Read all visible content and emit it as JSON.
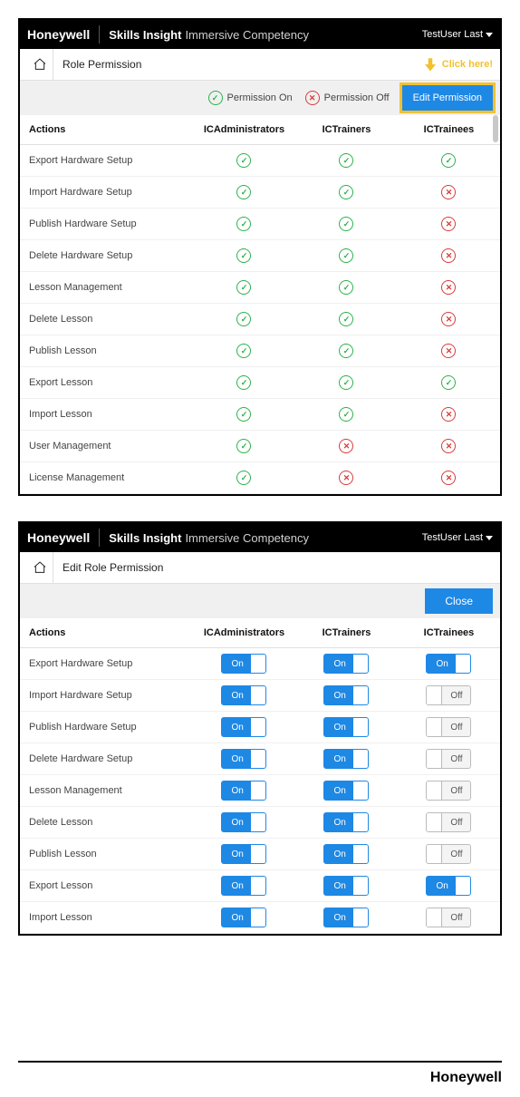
{
  "brand": "Honeywell",
  "app": {
    "name": "Skills Insight",
    "subtitle": "Immersive Competency"
  },
  "user": "TestUser Last",
  "panel1": {
    "breadcrumb": "Role Permission",
    "callout": "Click here!",
    "legend_on": "Permission On",
    "legend_off": "Permission Off",
    "edit_btn": "Edit Permission",
    "headers": {
      "actions": "Actions",
      "r1": "ICAdministrators",
      "r2": "ICTrainers",
      "r3": "ICTrainees"
    },
    "rows": [
      {
        "name": "Export Hardware Setup",
        "r1": true,
        "r2": true,
        "r3": true
      },
      {
        "name": "Import Hardware Setup",
        "r1": true,
        "r2": true,
        "r3": false
      },
      {
        "name": "Publish Hardware Setup",
        "r1": true,
        "r2": true,
        "r3": false
      },
      {
        "name": "Delete Hardware Setup",
        "r1": true,
        "r2": true,
        "r3": false
      },
      {
        "name": "Lesson Management",
        "r1": true,
        "r2": true,
        "r3": false
      },
      {
        "name": "Delete Lesson",
        "r1": true,
        "r2": true,
        "r3": false
      },
      {
        "name": "Publish Lesson",
        "r1": true,
        "r2": true,
        "r3": false
      },
      {
        "name": "Export Lesson",
        "r1": true,
        "r2": true,
        "r3": true
      },
      {
        "name": "Import Lesson",
        "r1": true,
        "r2": true,
        "r3": false
      },
      {
        "name": "User Management",
        "r1": true,
        "r2": false,
        "r3": false
      },
      {
        "name": "License Management",
        "r1": true,
        "r2": false,
        "r3": false
      }
    ]
  },
  "panel2": {
    "breadcrumb": "Edit Role Permission",
    "close_btn": "Close",
    "headers": {
      "actions": "Actions",
      "r1": "ICAdministrators",
      "r2": "ICTrainers",
      "r3": "ICTrainees"
    },
    "toggle_on": "On",
    "toggle_off": "Off",
    "rows": [
      {
        "name": "Export Hardware Setup",
        "r1": true,
        "r2": true,
        "r3": true
      },
      {
        "name": "Import Hardware Setup",
        "r1": true,
        "r2": true,
        "r3": false
      },
      {
        "name": "Publish Hardware Setup",
        "r1": true,
        "r2": true,
        "r3": false
      },
      {
        "name": "Delete Hardware Setup",
        "r1": true,
        "r2": true,
        "r3": false
      },
      {
        "name": "Lesson Management",
        "r1": true,
        "r2": true,
        "r3": false
      },
      {
        "name": "Delete Lesson",
        "r1": true,
        "r2": true,
        "r3": false
      },
      {
        "name": "Publish Lesson",
        "r1": true,
        "r2": true,
        "r3": false
      },
      {
        "name": "Export Lesson",
        "r1": true,
        "r2": true,
        "r3": true
      },
      {
        "name": "Import Lesson",
        "r1": true,
        "r2": true,
        "r3": false
      }
    ]
  },
  "footer_brand": "Honeywell"
}
